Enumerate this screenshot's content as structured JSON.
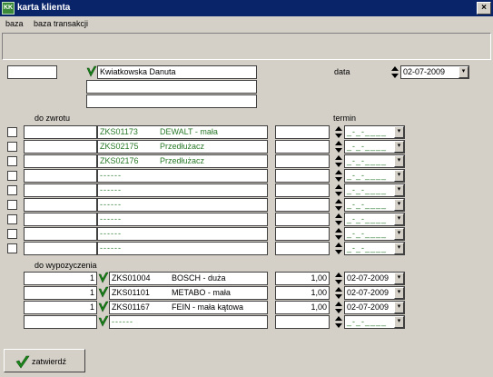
{
  "window": {
    "title": "karta klienta",
    "icon_text": "KK",
    "close_glyph": "×"
  },
  "menu": [
    {
      "label": "baza"
    },
    {
      "label": "baza transakcji"
    }
  ],
  "client": {
    "id_value": "",
    "name": "Kwiatkowska Danuta",
    "address_line1": "",
    "address_line2": ""
  },
  "date": {
    "label": "data",
    "value": "02-07-2009"
  },
  "returns": {
    "header_label": "do zwrotu",
    "term_label": "termin",
    "empty_date": "_-_-____",
    "rows": [
      {
        "code": "ZKS01173",
        "name": "DEWALT - mała"
      },
      {
        "code": "ZKS02175",
        "name": "Przedłużacz"
      },
      {
        "code": "ZKS02176",
        "name": "Przedłużacz"
      },
      {
        "code": "------",
        "name": ""
      },
      {
        "code": "------",
        "name": ""
      },
      {
        "code": "------",
        "name": ""
      },
      {
        "code": "------",
        "name": ""
      },
      {
        "code": "------",
        "name": ""
      },
      {
        "code": "------",
        "name": ""
      }
    ]
  },
  "rentals": {
    "header_label": "do wypozyczenia",
    "rows": [
      {
        "qty": "1",
        "code": "ZKS01004",
        "name": "BOSCH - duża",
        "price": "1,00",
        "date": "02-07-2009"
      },
      {
        "qty": "1",
        "code": "ZKS01101",
        "name": "METABO - mała",
        "price": "1,00",
        "date": "02-07-2009"
      },
      {
        "qty": "1",
        "code": "ZKS01167",
        "name": "FEIN - mała kątowa",
        "price": "1,00",
        "date": "02-07-2009"
      },
      {
        "qty": "",
        "code": "------",
        "name": "",
        "price": "",
        "date": "_-_-____"
      }
    ]
  },
  "buttons": {
    "confirm": "zatwierdź"
  },
  "colors": {
    "titlebar": "#0a246a",
    "face": "#d4d0c8",
    "item_text": "#2a7a2a",
    "check": "#1a8a1a"
  }
}
